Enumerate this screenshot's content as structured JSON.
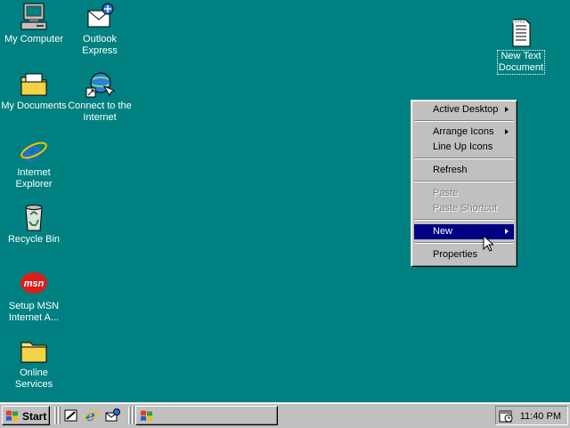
{
  "desktop": {
    "icons": [
      {
        "label": "My Computer"
      },
      {
        "label": "Outlook\nExpress"
      },
      {
        "label": "My Documents"
      },
      {
        "label": "Connect to the\nInternet"
      },
      {
        "label": "Internet\nExplorer"
      },
      {
        "label": "Recycle Bin"
      },
      {
        "label": "Setup MSN\nInternet A..."
      },
      {
        "label": "Online\nServices"
      },
      {
        "label": "New Text\nDocument"
      }
    ],
    "msn_logo_text": "msn",
    "background_color": "#008080"
  },
  "context_menu": {
    "items": [
      {
        "label": "Active Desktop",
        "submenu": true,
        "enabled": true
      },
      {
        "label": "Arrange Icons",
        "submenu": true,
        "enabled": true
      },
      {
        "label": "Line Up Icons",
        "submenu": false,
        "enabled": true
      },
      {
        "label": "Refresh",
        "submenu": false,
        "enabled": true
      },
      {
        "label": "Paste",
        "submenu": false,
        "enabled": false
      },
      {
        "label": "Paste Shortcut",
        "submenu": false,
        "enabled": false
      },
      {
        "label": "New",
        "submenu": true,
        "enabled": true,
        "highlighted": true
      },
      {
        "label": "Properties",
        "submenu": false,
        "enabled": true
      }
    ],
    "highlight_color": "#000080"
  },
  "taskbar": {
    "start_label": "Start",
    "quick_launch": [
      "show-desktop-icon",
      "internet-explorer-icon",
      "outlook-express-icon"
    ],
    "clock": "11:40 PM"
  }
}
